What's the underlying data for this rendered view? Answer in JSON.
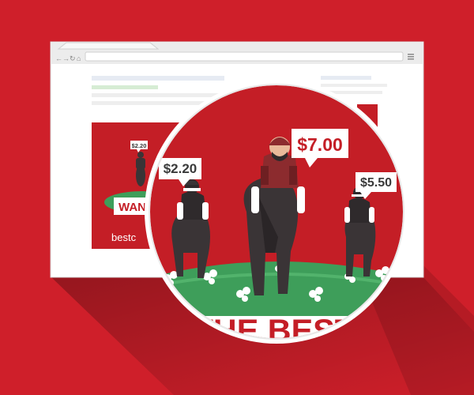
{
  "colors": {
    "background": "#cf1f2a",
    "background_dark": "#a6161f",
    "browser_chrome": "#e9e9e9",
    "browser_page": "#ffffff",
    "ad_red": "#c41e26",
    "grass": "#3e9e5a",
    "horse": "#3a3436",
    "jockey_silks": "#8c2b2e"
  },
  "browser": {
    "address_bar_text": "",
    "nav_icons": [
      "back-icon",
      "forward-icon",
      "reload-icon",
      "home-icon"
    ],
    "menu_icon": "hamburger-menu-icon"
  },
  "small_ad": {
    "odds_label": "$2.20",
    "headline_fragment": "WAN",
    "brand_fragment": "bestc"
  },
  "magnifier": {
    "odds": [
      {
        "label": "$2.20"
      },
      {
        "label": "$7.00"
      },
      {
        "label": "$5.50"
      }
    ],
    "headline_fragment": "T THE BEST OI"
  }
}
